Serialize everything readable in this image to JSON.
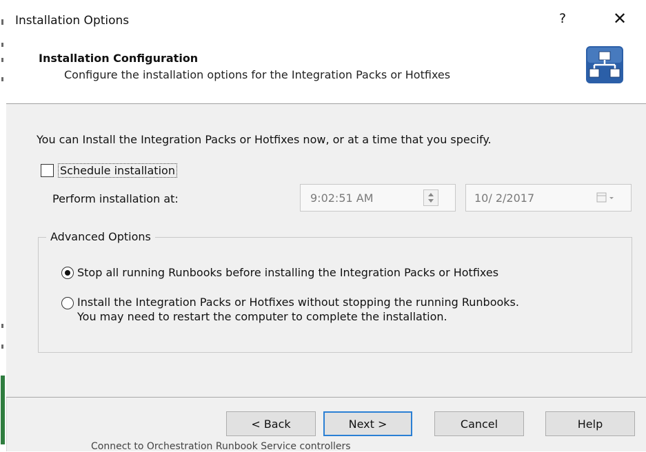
{
  "window": {
    "title": "Installation Options",
    "help_glyph": "?",
    "close_glyph": "✕"
  },
  "header": {
    "title": "Installation Configuration",
    "subtitle": "Configure the installation options for the Integration Packs or Hotfixes",
    "icon": "network-topology-icon"
  },
  "body": {
    "intro": "You can Install the Integration Packs or Hotfixes now, or at a time that you specify.",
    "schedule": {
      "label": "Schedule installation",
      "checked": false
    },
    "perform_label": "Perform installation at:",
    "time_value": "9:02:51 AM",
    "date_value": "10/ 2/2017"
  },
  "advanced": {
    "legend": "Advanced Options",
    "option_stop": "Stop all running Runbooks before installing the Integration Packs or Hotfixes",
    "option_install_line1": "Install the Integration Packs or Hotfixes without stopping the running Runbooks.",
    "option_install_line2": "You may need to restart the computer to complete the installation.",
    "selected": "stop"
  },
  "buttons": {
    "back": "< Back",
    "next": "Next >",
    "cancel": "Cancel",
    "help": "Help"
  },
  "background_text": "Connect to Orchestration Runbook Service controllers",
  "colors": {
    "accent": "#2a7fd4",
    "icon_blue": "#2b5fa8",
    "dialog_bg": "#f0f0f0"
  }
}
